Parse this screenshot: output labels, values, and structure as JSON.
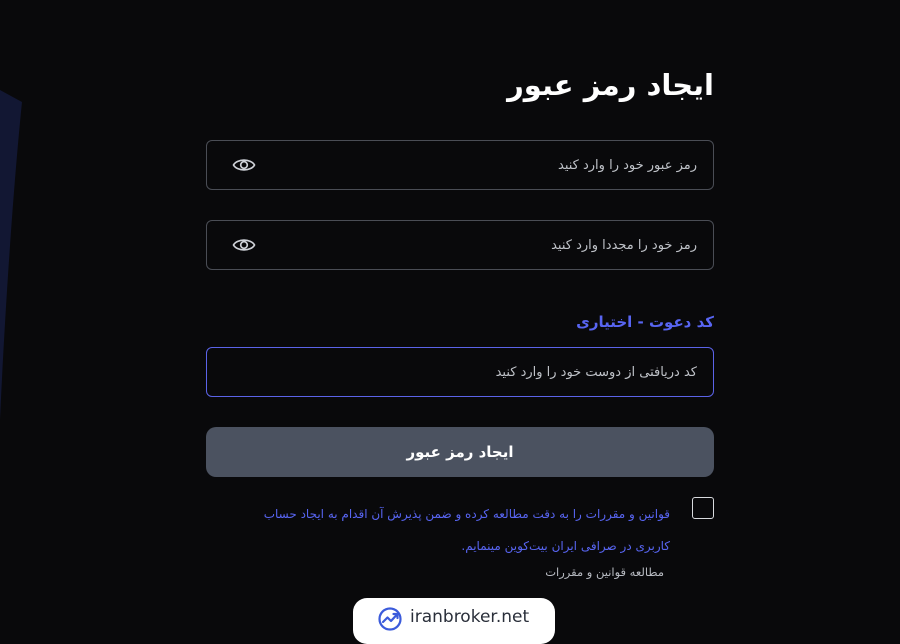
{
  "page": {
    "title": "ایجاد رمز عبور"
  },
  "password": {
    "placeholder": "رمز عبور خود را وارد کنید",
    "icon": "eye-icon"
  },
  "password_confirm": {
    "placeholder": "رمز خود را مجددا وارد کنید",
    "icon": "eye-icon"
  },
  "invite": {
    "label": "کد دعوت - اختیاری",
    "placeholder": "کد دریافتی از دوست خود را وارد کنید"
  },
  "submit_label": "ایجاد رمز عبور",
  "terms": {
    "text": "قوانین و مقررات را به دقت مطالعه کرده و ضمن پذیرش آن اقدام به ایجاد حساب کاربری در صرافی ایران بیت‌کوین مینمایم.",
    "link_label": "مطالعه قوانین و مقررات",
    "checked": false
  },
  "watermark": {
    "text": "iranbroker.net"
  },
  "colors": {
    "background": "#09090b",
    "accent": "#5865f2",
    "button": "#4b5260",
    "field_border": "#4a4d55",
    "side_shape": "#141a38"
  }
}
